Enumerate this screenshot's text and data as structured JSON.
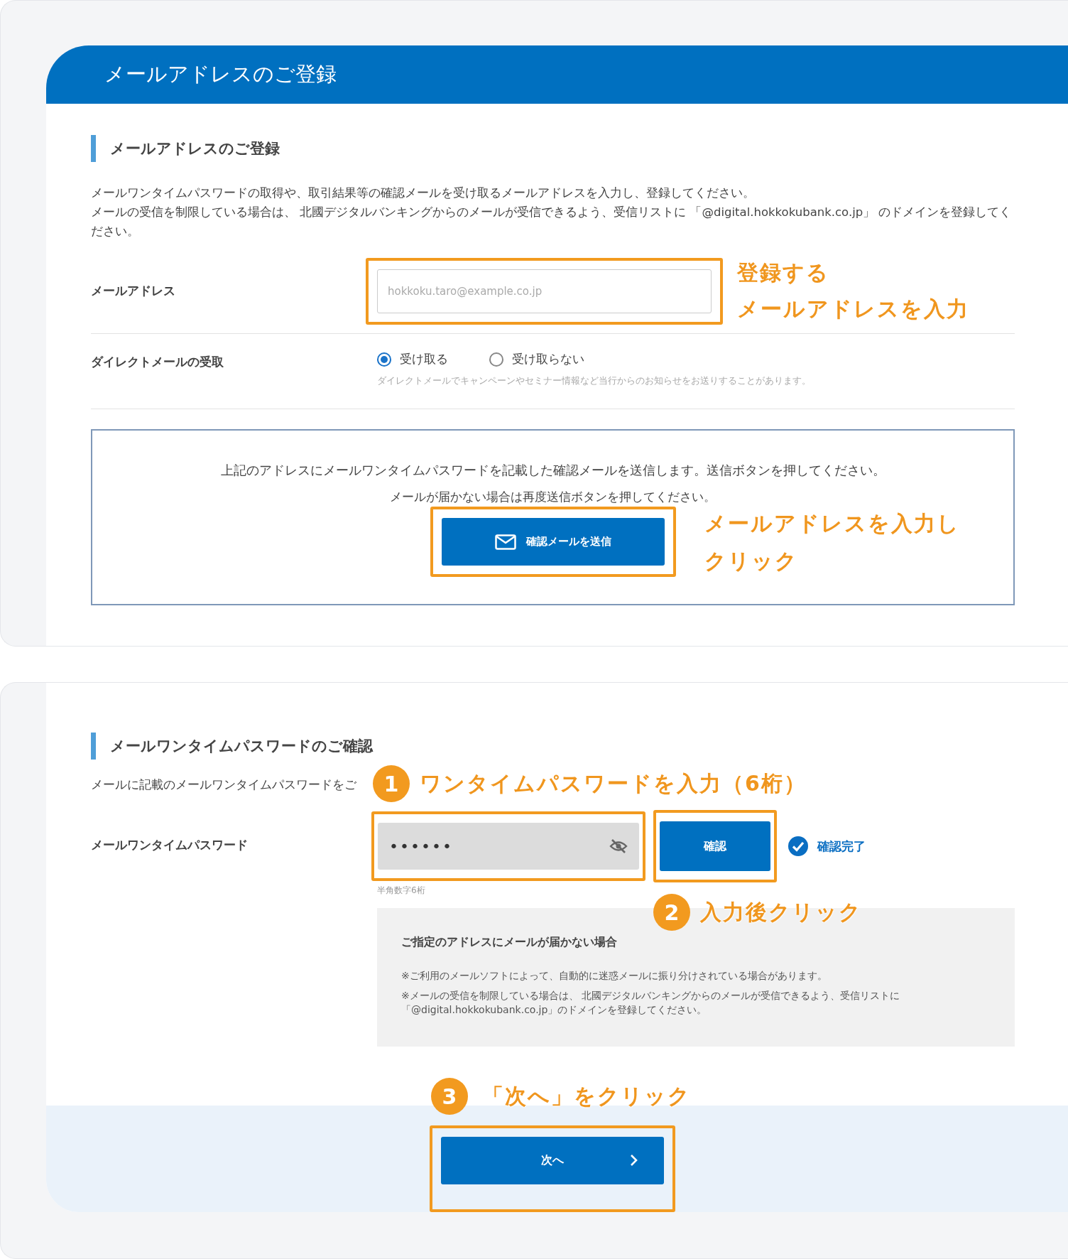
{
  "header": {
    "title": "メールアドレスのご登録"
  },
  "email_section": {
    "heading": "メールアドレスのご登録",
    "description": [
      "メールワンタイムパスワードの取得や、取引結果等の確認メールを受け取るメールアドレスを入力し、登録してください。",
      "メールの受信を制限している場合は、 北國デジタルバンキングからのメールが受信できるよう、受信リストに 「@digital.hokkokubank.co.jp」 のドメインを登録してください。"
    ],
    "email_field": {
      "label": "メールアドレス",
      "placeholder": "hokkoku.taro@example.co.jp",
      "annotation": [
        "登録する",
        "メールアドレスを入力"
      ]
    },
    "direct_mail": {
      "label": "ダイレクトメールの受取",
      "options": [
        {
          "label": "受け取る",
          "selected": true
        },
        {
          "label": "受け取らない",
          "selected": false
        }
      ],
      "note": "ダイレクトメールでキャンペーンやセミナー情報など当行からのお知らせをお送りすることがあります。"
    },
    "notice": {
      "lines": [
        "上記のアドレスにメールワンタイムパスワードを記載した確認メールを送信します。送信ボタンを押してください。",
        "メールが届かない場合は再度送信ボタンを押してください。"
      ],
      "button": "確認メールを送信",
      "annotation": [
        "メールアドレスを入力し",
        "クリック"
      ]
    }
  },
  "otp_section": {
    "heading": "メールワンタイムパスワードのご確認",
    "description": "メールに記載のメールワンタイムパスワードをご",
    "step1": {
      "number": "1",
      "text": "ワンタイムパスワードを入力（6桁）"
    },
    "otp_field": {
      "label": "メールワンタイムパスワード",
      "value": "••••••",
      "hint": "半角数字6桁"
    },
    "confirm_button": "確認",
    "status": "確認完了",
    "step2": {
      "number": "2",
      "text": "入力後クリック"
    },
    "help": {
      "title": "ご指定のアドレスにメールが届かない場合",
      "lines": [
        "※ご利用のメールソフトによって、自動的に迷惑メールに振り分けされている場合があります。",
        "※メールの受信を制限している場合は、 北國デジタルバンキングからのメールが受信できるよう、受信リストに",
        "「@digital.hokkokubank.co.jp」のドメインを登録してください。"
      ]
    }
  },
  "footer": {
    "step3": {
      "number": "3",
      "text": "「次へ」をクリック"
    },
    "next_button": "次へ"
  }
}
